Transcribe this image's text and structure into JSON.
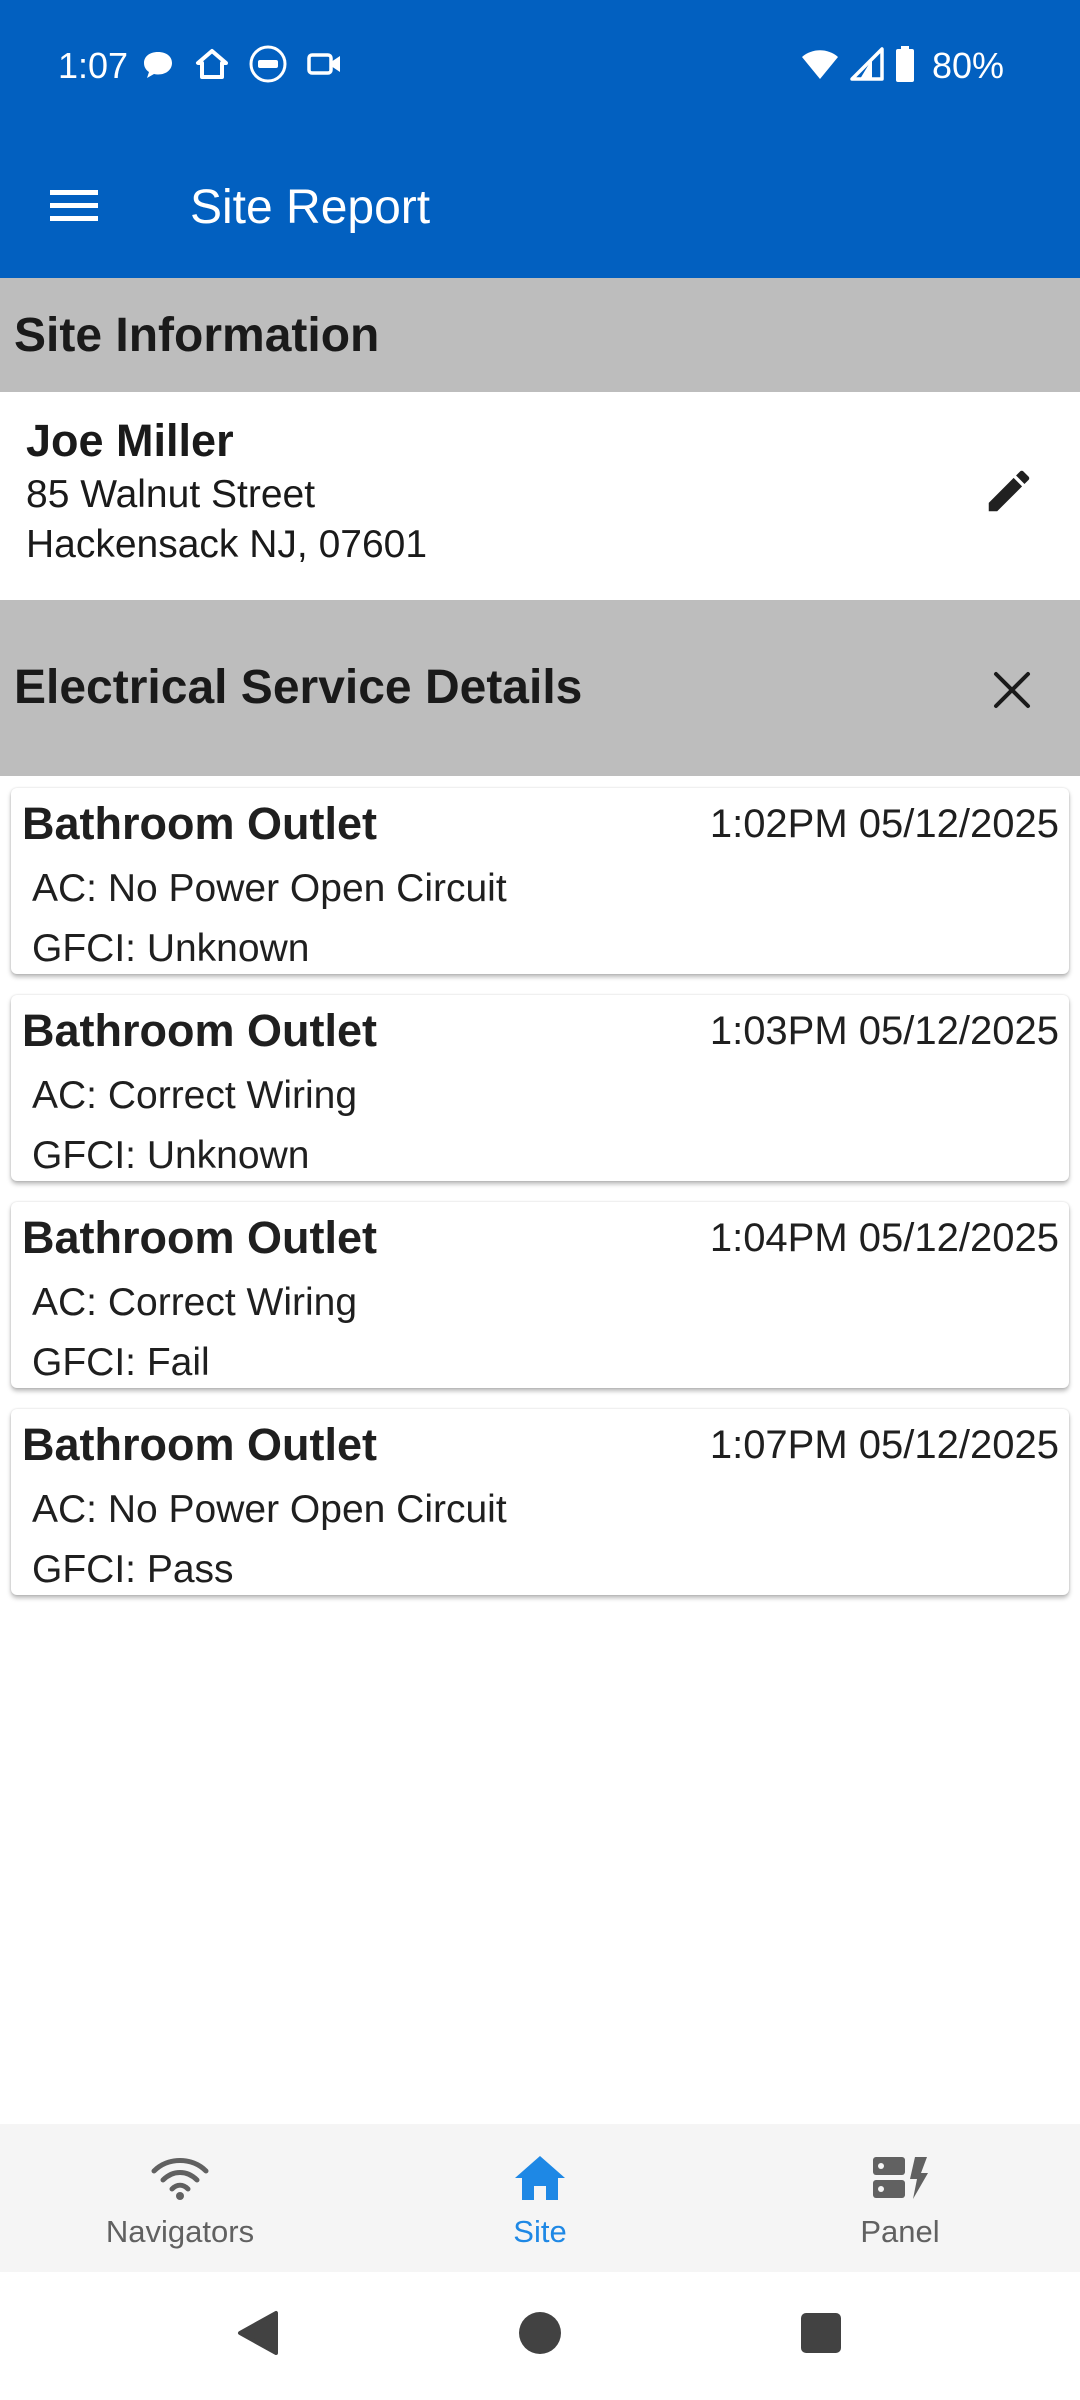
{
  "status_bar": {
    "time": "1:07",
    "battery": "80%",
    "icons_left": [
      "chat-bubble-icon",
      "home-outline-icon",
      "adt-logo-icon",
      "video-camera-icon"
    ],
    "icons_right": [
      "wifi-icon",
      "cell-signal-icon",
      "battery-icon"
    ]
  },
  "app_bar": {
    "title": "Site Report",
    "menu_icon": "menu-icon"
  },
  "site_info": {
    "header": "Site Information",
    "name": "Joe Miller",
    "street": "85 Walnut Street",
    "city_line": "Hackensack NJ, 07601",
    "edit_icon": "pencil-icon"
  },
  "electrical": {
    "header": "Electrical Service Details",
    "close_icon": "close-icon",
    "records": [
      {
        "title": "Bathroom Outlet",
        "time": "1:02PM 05/12/2025",
        "ac": "AC: No Power Open Circuit",
        "gfci": "GFCI: Unknown"
      },
      {
        "title": "Bathroom Outlet",
        "time": "1:03PM 05/12/2025",
        "ac": "AC: Correct Wiring",
        "gfci": "GFCI: Unknown"
      },
      {
        "title": "Bathroom Outlet",
        "time": "1:04PM 05/12/2025",
        "ac": "AC: Correct Wiring",
        "gfci": "GFCI: Fail"
      },
      {
        "title": "Bathroom Outlet",
        "time": "1:07PM 05/12/2025",
        "ac": "AC: No Power Open Circuit",
        "gfci": "GFCI: Pass"
      }
    ]
  },
  "bottom_nav": {
    "items": [
      {
        "label": "Navigators",
        "icon": "wifi-icon",
        "active": false
      },
      {
        "label": "Site",
        "icon": "home-icon",
        "active": true
      },
      {
        "label": "Panel",
        "icon": "electrical-panel-icon",
        "active": false
      }
    ]
  },
  "system_nav": [
    "back-icon",
    "home-circle-icon",
    "recents-icon"
  ],
  "colors": {
    "primary": "#0260c0",
    "section_header_bg": "#bdbdbd",
    "active_nav": "#1e88e5",
    "inactive_nav": "#616161",
    "text": "#1f1f1f"
  }
}
